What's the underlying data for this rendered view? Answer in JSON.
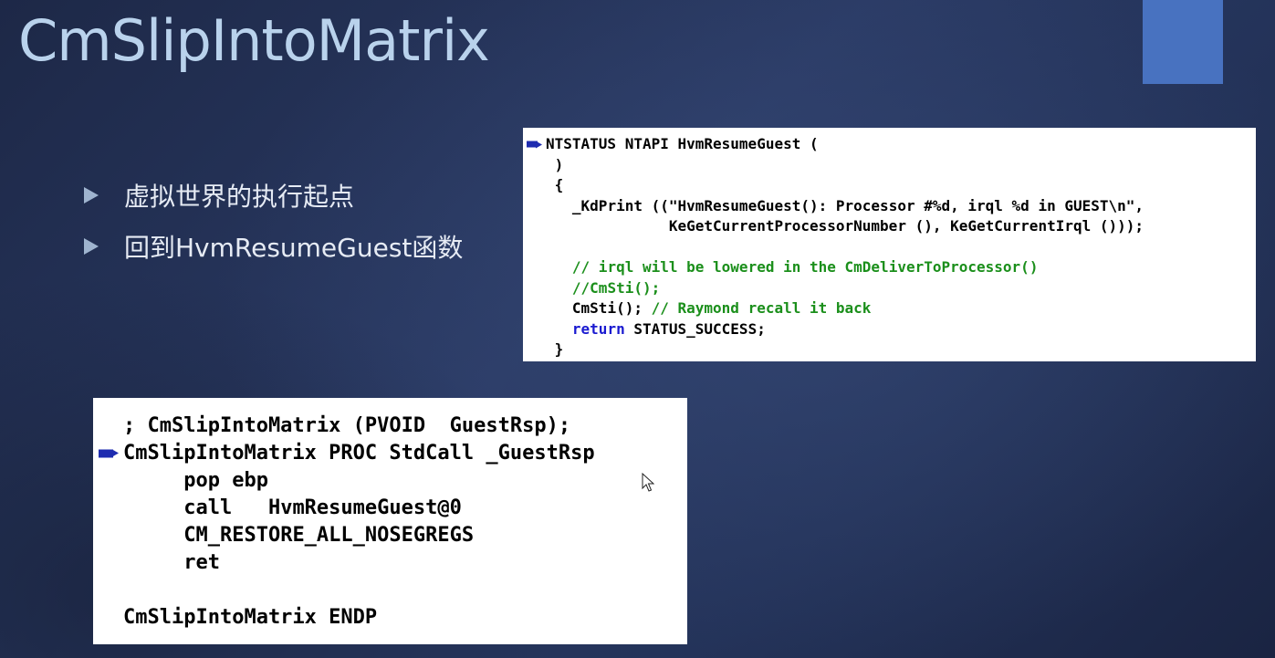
{
  "slide": {
    "title": "CmSlipIntoMatrix",
    "accent_color": "#4872c0",
    "title_color": "#b9d2ec",
    "bullets": [
      {
        "icon": "triangle-bullet-icon",
        "text": "虚拟世界的执行起点"
      },
      {
        "icon": "triangle-bullet-icon",
        "text": "回到HvmResumeGuest函数"
      }
    ]
  },
  "code_c": {
    "language": "C",
    "lines": [
      {
        "marker": true,
        "indent": "",
        "segments": [
          {
            "type": "plain",
            "text": "NTSTATUS NTAPI HvmResumeGuest ("
          }
        ]
      },
      {
        "marker": false,
        "indent": " ",
        "segments": [
          {
            "type": "plain",
            "text": ")"
          }
        ]
      },
      {
        "marker": false,
        "indent": " ",
        "segments": [
          {
            "type": "plain",
            "text": "{"
          }
        ]
      },
      {
        "marker": false,
        "indent": "   ",
        "segments": [
          {
            "type": "plain",
            "text": "_KdPrint ((\"HvmResumeGuest(): Processor #%d, irql %d in GUEST\\n\","
          }
        ]
      },
      {
        "marker": false,
        "indent": "              ",
        "segments": [
          {
            "type": "plain",
            "text": "KeGetCurrentProcessorNumber (), KeGetCurrentIrql ()));"
          }
        ]
      },
      {
        "marker": false,
        "indent": "",
        "segments": [
          {
            "type": "plain",
            "text": ""
          }
        ]
      },
      {
        "marker": false,
        "indent": "   ",
        "segments": [
          {
            "type": "comment",
            "text": "// irql will be lowered in the CmDeliverToProcessor()"
          }
        ]
      },
      {
        "marker": false,
        "indent": "   ",
        "segments": [
          {
            "type": "comment",
            "text": "//CmSti();"
          }
        ]
      },
      {
        "marker": false,
        "indent": "   ",
        "segments": [
          {
            "type": "plain",
            "text": "CmSti(); "
          },
          {
            "type": "comment",
            "text": "// Raymond recall it back"
          }
        ]
      },
      {
        "marker": false,
        "indent": "   ",
        "segments": [
          {
            "type": "keyword",
            "text": "return"
          },
          {
            "type": "plain",
            "text": " STATUS_SUCCESS;"
          }
        ]
      },
      {
        "marker": false,
        "indent": " ",
        "segments": [
          {
            "type": "plain",
            "text": "}"
          }
        ]
      }
    ]
  },
  "code_asm": {
    "language": "ASM",
    "lines": [
      {
        "marker": false,
        "indent": "",
        "segments": [
          {
            "type": "plain",
            "text": "; CmSlipIntoMatrix (PVOID  GuestRsp);"
          }
        ]
      },
      {
        "marker": true,
        "indent": "",
        "segments": [
          {
            "type": "plain",
            "text": "CmSlipIntoMatrix PROC StdCall _GuestRsp"
          }
        ]
      },
      {
        "marker": false,
        "indent": "     ",
        "segments": [
          {
            "type": "plain",
            "text": "pop ebp"
          }
        ]
      },
      {
        "marker": false,
        "indent": "     ",
        "segments": [
          {
            "type": "plain",
            "text": "call   HvmResumeGuest@0"
          }
        ]
      },
      {
        "marker": false,
        "indent": "     ",
        "segments": [
          {
            "type": "plain",
            "text": "CM_RESTORE_ALL_NOSEGREGS"
          }
        ]
      },
      {
        "marker": false,
        "indent": "     ",
        "segments": [
          {
            "type": "plain",
            "text": "ret"
          }
        ]
      },
      {
        "marker": false,
        "indent": "",
        "segments": [
          {
            "type": "plain",
            "text": ""
          }
        ]
      },
      {
        "marker": false,
        "indent": "",
        "segments": [
          {
            "type": "plain",
            "text": "CmSlipIntoMatrix ENDP"
          }
        ]
      }
    ]
  },
  "colors": {
    "keyword": "#1a1ad0",
    "comment": "#1b8f1b",
    "breakpoint_marker": "#1e2cb0"
  },
  "cursor": {
    "icon": "mouse-pointer-icon"
  }
}
